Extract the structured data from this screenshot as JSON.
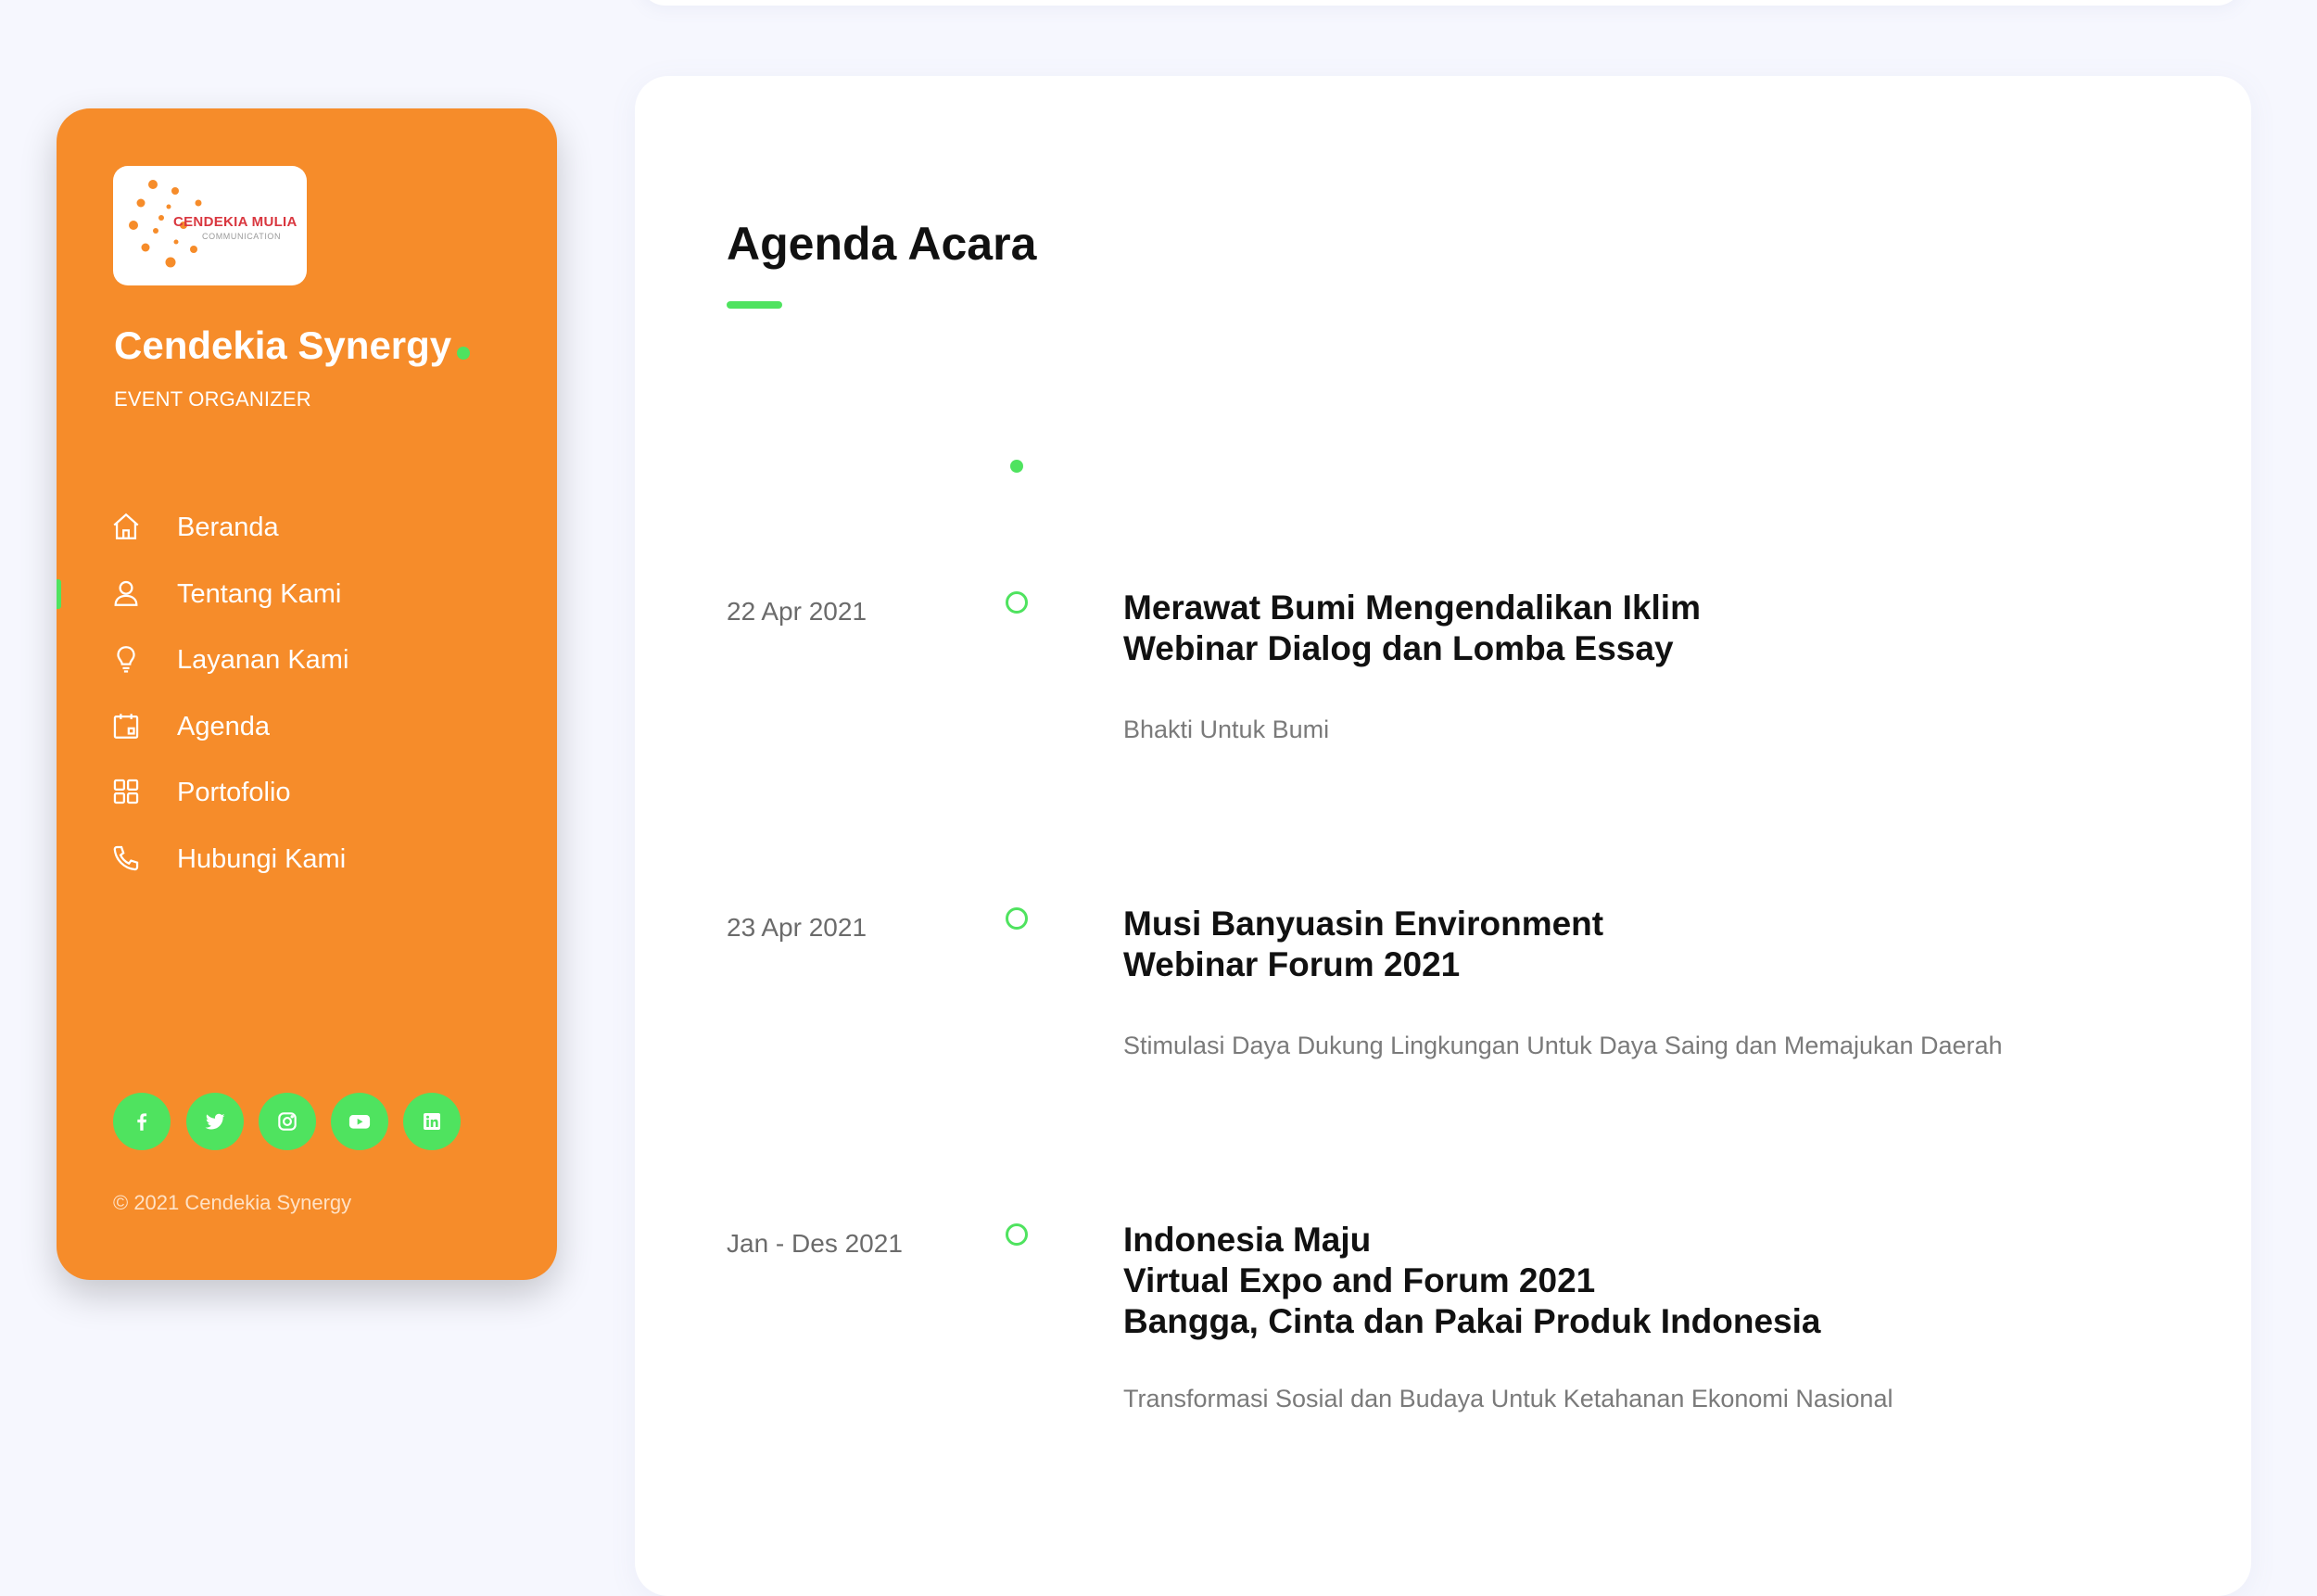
{
  "brand": {
    "logo_text_main": "CENDEKIA MULIA",
    "logo_text_sub": "COMMUNICATION",
    "name": "Cendekia Synergy",
    "tagline": "EVENT ORGANIZER"
  },
  "nav": [
    {
      "label": "Beranda",
      "icon": "home-icon"
    },
    {
      "label": "Tentang Kami",
      "icon": "user-icon",
      "active": true
    },
    {
      "label": "Layanan Kami",
      "icon": "lightbulb-icon"
    },
    {
      "label": "Agenda",
      "icon": "calendar-icon"
    },
    {
      "label": "Portofolio",
      "icon": "grid-icon"
    },
    {
      "label": "Hubungi Kami",
      "icon": "phone-icon"
    }
  ],
  "social": [
    "facebook-icon",
    "twitter-icon",
    "instagram-icon",
    "youtube-icon",
    "linkedin-icon"
  ],
  "footer": {
    "copyright": "© 2021 Cendekia Synergy"
  },
  "main": {
    "title": "Agenda Acara",
    "agenda": [
      {
        "date": "22 Apr 2021",
        "title_lines": [
          "Merawat Bumi Mengendalikan Iklim",
          "Webinar Dialog dan Lomba Essay"
        ],
        "description": "Bhakti Untuk Bumi"
      },
      {
        "date": "23 Apr 2021",
        "title_lines": [
          "Musi Banyuasin Environment",
          "Webinar Forum 2021"
        ],
        "description": "Stimulasi Daya Dukung Lingkungan Untuk Daya Saing dan Memajukan Daerah"
      },
      {
        "date": "Jan - Des 2021",
        "title_lines": [
          "Indonesia Maju",
          "Virtual Expo and Forum 2021",
          "Bangga, Cinta dan Pakai Produk Indonesia"
        ],
        "description": "Transformasi Sosial dan Budaya Untuk Ketahanan Ekonomi Nasional"
      }
    ]
  },
  "colors": {
    "accent": "#4fe35f",
    "sidebar": "#f68c2a",
    "background": "#f6f7fe"
  }
}
